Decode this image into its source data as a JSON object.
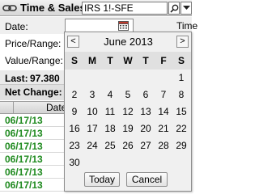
{
  "window": {
    "title": "Time & Sales",
    "symbol": "IRS 1!-SFE",
    "icons": {
      "link": "link-chain-icon",
      "search": "search-icon",
      "dropdown": "chevron-down-icon"
    }
  },
  "fields": {
    "date_label": "Date:",
    "time_label": "Time",
    "price_range_label": "Price/Range:",
    "value_range_label": "Value/Range:",
    "last_label": "Last:",
    "last_value": "97.380",
    "net_change_label": "Net Change:"
  },
  "table": {
    "header": "Date",
    "rows": [
      "06/17/13",
      "06/17/13",
      "06/17/13",
      "06/17/13",
      "06/17/13",
      "06/17/13"
    ],
    "date_color": "#1f8a1f"
  },
  "calendar": {
    "prev_label": "<",
    "next_label": ">",
    "month": "June 2013",
    "weekdays": [
      "S",
      "M",
      "T",
      "W",
      "T",
      "F",
      "S"
    ],
    "weeks": [
      [
        "",
        "",
        "",
        "",
        "",
        "",
        "1"
      ],
      [
        "2",
        "3",
        "4",
        "5",
        "6",
        "7",
        "8"
      ],
      [
        "9",
        "10",
        "11",
        "12",
        "13",
        "14",
        "15"
      ],
      [
        "16",
        "17",
        "18",
        "19",
        "20",
        "21",
        "22"
      ],
      [
        "23",
        "24",
        "25",
        "26",
        "27",
        "28",
        "29"
      ],
      [
        "30",
        "",
        "",
        "",
        "",
        "",
        ""
      ]
    ],
    "today_label": "Today",
    "cancel_label": "Cancel"
  }
}
